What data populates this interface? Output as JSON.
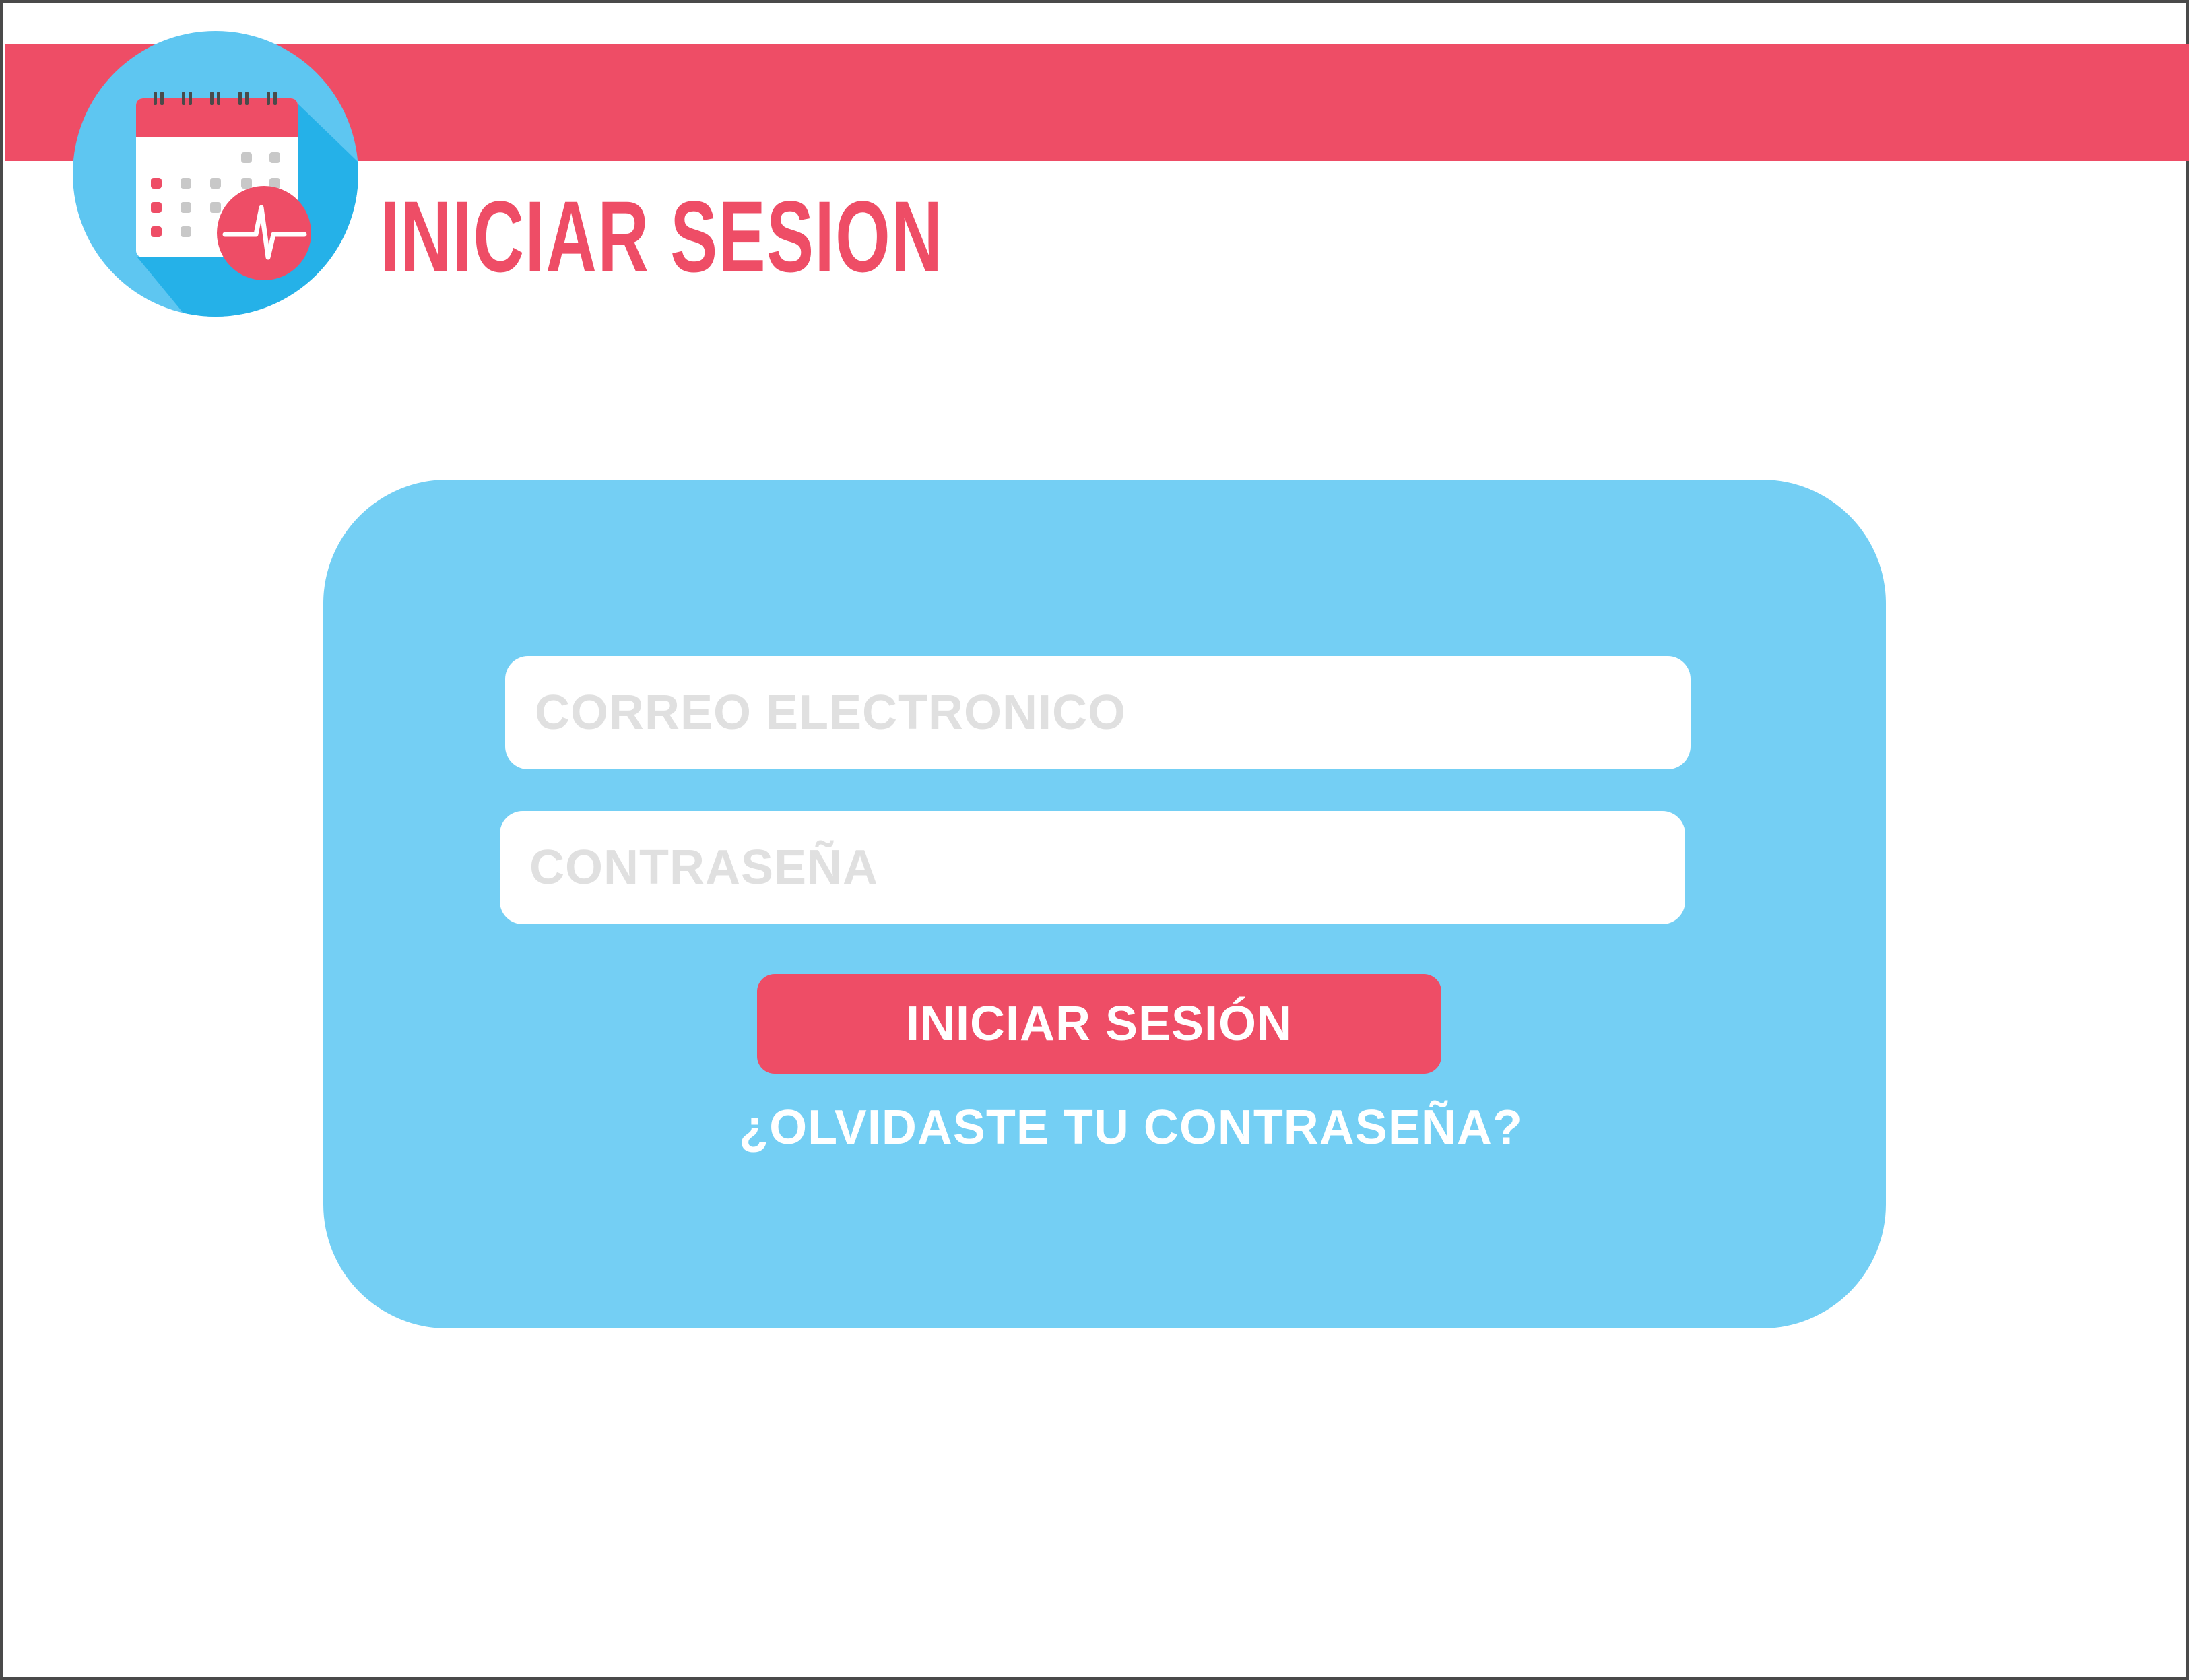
{
  "header": {
    "title": "INICIAR SESION",
    "logo_icon": "calendar-heartbeat-icon",
    "bar_color": "#ee4d66"
  },
  "login_form": {
    "email": {
      "placeholder": "CORREO ELECTRONICO",
      "value": ""
    },
    "password": {
      "placeholder": "CONTRASEÑA",
      "value": ""
    },
    "submit_label": "INICIAR SESIÓN",
    "forgot_password_label": "¿OLVIDASTE TU CONTRASEÑA?",
    "card_color": "#74cff4",
    "accent_color": "#ee4d66"
  }
}
